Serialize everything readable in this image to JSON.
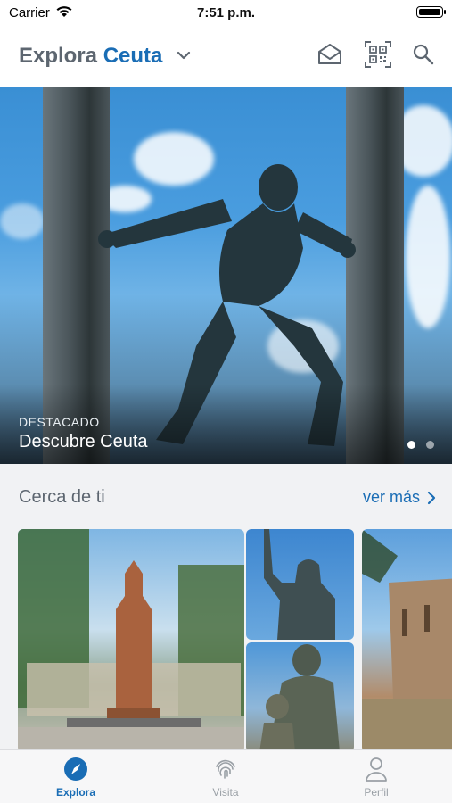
{
  "status_bar": {
    "carrier": "Carrier",
    "time": "7:51 p.m."
  },
  "header": {
    "title_part1": "Explora",
    "title_part2": "Ceuta"
  },
  "hero": {
    "kicker": "DESTACADO",
    "headline": "Descubre Ceuta",
    "page_count": 2,
    "active_page": 1
  },
  "nearby": {
    "title": "Cerca de ti",
    "more_label": "ver más"
  },
  "tabs": [
    {
      "label": "Explora",
      "active": true
    },
    {
      "label": "Visita",
      "active": false
    },
    {
      "label": "Perfil",
      "active": false
    }
  ],
  "colors": {
    "accent": "#1a6db5",
    "title_gray": "#5d6670",
    "section_bg": "#f1f2f4"
  }
}
